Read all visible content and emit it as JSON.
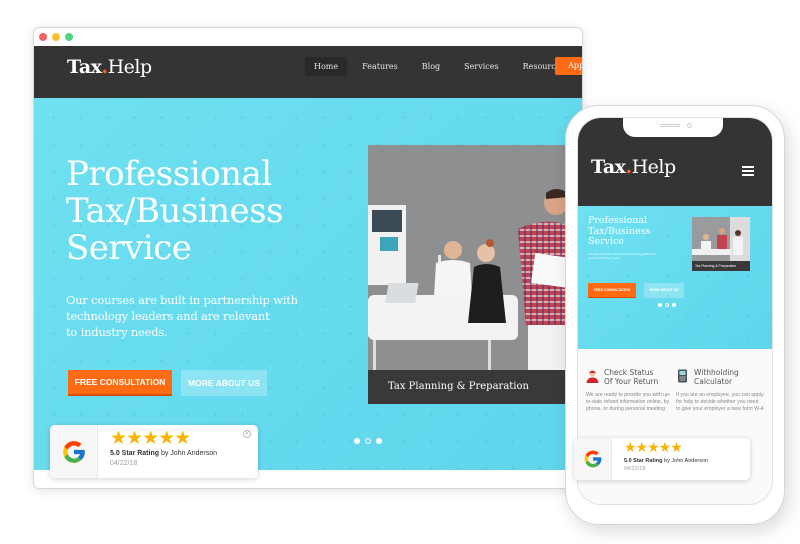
{
  "browser": {
    "window_dots": [
      {
        "name": "close",
        "color": "#f46163"
      },
      {
        "name": "minimize",
        "color": "#fbc22f"
      },
      {
        "name": "maximize",
        "color": "#4fd47e"
      }
    ]
  },
  "site": {
    "logo": {
      "bold": "Tax",
      "dot": ".",
      "light": "Help"
    },
    "nav": {
      "items": [
        {
          "label": "Home",
          "active": true
        },
        {
          "label": "Features",
          "active": false
        },
        {
          "label": "Blog",
          "active": false
        },
        {
          "label": "Services",
          "active": false
        },
        {
          "label": "Resources",
          "active": false
        }
      ],
      "cta_label": "Appointment!",
      "search_icon": "search-icon"
    },
    "hero": {
      "title_lines": [
        "Professional",
        "Tax/Business",
        "Service"
      ],
      "subtitle_lines": [
        "Our courses are built in partnership with",
        "technology leaders and are relevant",
        "to industry needs."
      ],
      "primary_button": "FREE CONSULTATION",
      "secondary_button": "MORE ABOUT US",
      "photo_caption": "Tax Planning & Preparation",
      "slides": {
        "count": 3,
        "active": 2
      }
    },
    "review": {
      "stars": "★★★★★",
      "rating_label": "5.0 Star Rating",
      "by_text": " by John Anderson",
      "date": "04/22/18",
      "close_glyph": "×"
    }
  },
  "mobile": {
    "features": [
      {
        "icon": "user-support-icon",
        "title_lines": [
          "Check Status",
          "Of Your Return"
        ],
        "text": "We are ready to provide you with up-to-date refund information online, by phone, or during personal meeting"
      },
      {
        "icon": "calculator-icon",
        "title_lines": [
          "Withholding",
          "Calculator"
        ],
        "text": "If you are an employee, you can apply for help to decide whether you need to give your employer a new form W-4"
      }
    ]
  },
  "colors": {
    "accent": "#ff6a13",
    "nav_bg": "#353334",
    "hero_bg": "#66dbef",
    "star": "#f7b500"
  }
}
